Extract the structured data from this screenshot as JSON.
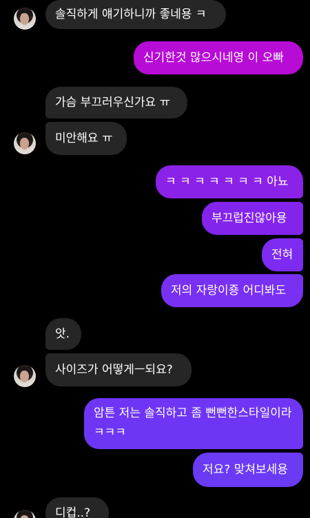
{
  "messages": [
    {
      "side": "in",
      "text": "솔직하게 얘기하니까 좋네용 ㅋ"
    },
    {
      "side": "out",
      "text": "신기한것 많으시네영 이 오빠"
    },
    {
      "side": "in",
      "text": "가슴 부끄러우신가요 ㅠ"
    },
    {
      "side": "in",
      "text": "미안해요 ㅠ"
    },
    {
      "side": "out",
      "text": "ㅋ ㅋ ㅋ ㅋ ㅋ ㅋ ㅋ 아뇨"
    },
    {
      "side": "out",
      "text": "부끄럽진않아용"
    },
    {
      "side": "out",
      "text": "전혀"
    },
    {
      "side": "out",
      "text": "저의 자랑이죵 어디봐도"
    },
    {
      "side": "in",
      "text": "앗."
    },
    {
      "side": "in",
      "text": "사이즈가 어떻게ㅡ되요?"
    },
    {
      "side": "out",
      "text": "암튼 저는 솔직하고 좀 뻔뻔한스타일이라 ㅋㅋㅋ"
    },
    {
      "side": "out",
      "text": "저요? 맞쳐보세용"
    },
    {
      "side": "in",
      "text": "디컵..?"
    }
  ],
  "colors": {
    "incoming": "#262626",
    "outgoing_magenta": "#b70bd6",
    "outgoing_purple": "#7b2cf0",
    "background": "#000000"
  },
  "icons": {
    "avatar": "contact-profile-photo"
  }
}
